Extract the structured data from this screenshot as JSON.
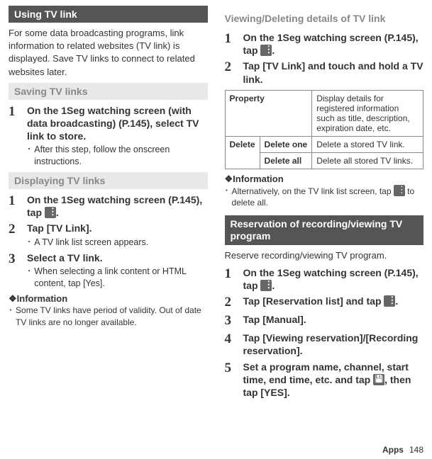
{
  "left": {
    "h_using": "Using TV link",
    "intro": "For some data broadcasting programs, link information to related websites (TV link) is displayed. Save TV links to connect to related websites later.",
    "h_saving": "Saving TV links",
    "save1_title": "On the 1Seg watching screen (with data broadcasting) (P.145), select TV link to store.",
    "save1_bullet": "After this step, follow the onscreen instructions.",
    "h_display": "Displaying TV links",
    "disp1_title_a": "On the 1Seg watching screen (P.145), tap ",
    "disp1_title_b": ".",
    "disp2_title": "Tap [TV Link].",
    "disp2_bullet": "A TV link list screen appears.",
    "disp3_title": "Select a TV link.",
    "disp3_bullet": "When selecting a link content or HTML content, tap [Yes].",
    "info_title": "❖Information",
    "info_bullet": "Some TV links have period of validity. Out of date TV links are no longer available."
  },
  "right": {
    "h_view": "Viewing/Deleting details of TV link",
    "v1_a": "On the 1Seg watching screen (P.145), tap ",
    "v1_b": ".",
    "v2": "Tap [TV Link] and touch and hold a TV link.",
    "tbl": {
      "property": "Property",
      "property_desc": "Display details for registered information such as title, description, expiration date, etc.",
      "delete": "Delete",
      "delete_one": "Delete one",
      "delete_one_desc": "Delete a stored TV link.",
      "delete_all": "Delete all",
      "delete_all_desc": "Delete all stored TV links."
    },
    "info_title": "❖Information",
    "info_bullet_a": "Alternatively, on the TV link list screen, tap ",
    "info_bullet_b": " to delete all.",
    "h_res": "Reservation of recording/viewing TV program",
    "res_intro": "Reserve recording/viewing TV program.",
    "r1_a": "On the 1Seg watching screen (P.145), tap ",
    "r1_b": ".",
    "r2_a": "Tap [Reservation list] and tap ",
    "r2_b": ".",
    "r3": "Tap [Manual].",
    "r4": "Tap [Viewing reservation]/[Recording reservation].",
    "r5_a": "Set a program name, channel, start time, end time, etc. and tap ",
    "r5_b": ", then tap [YES]."
  },
  "footer": {
    "apps": "Apps",
    "page": "148"
  }
}
